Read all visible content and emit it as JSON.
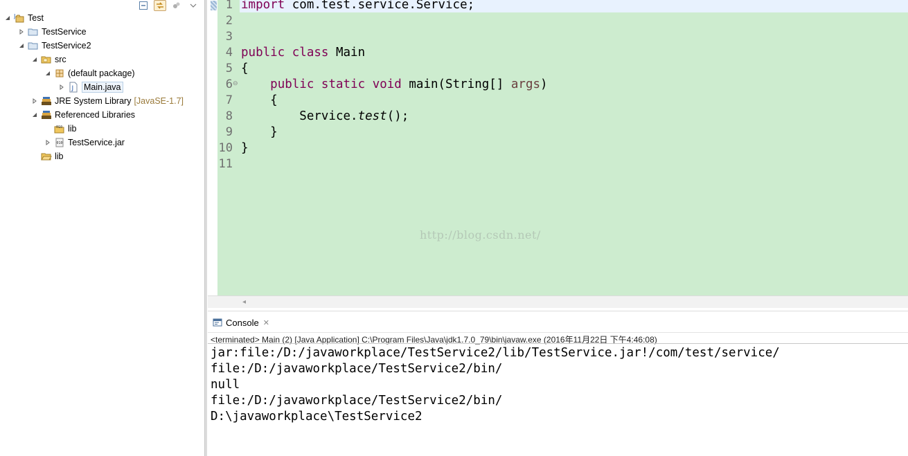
{
  "explorer": {
    "tree": [
      {
        "label": "Test",
        "decor": "",
        "icon": "project-icon",
        "twisty": "expanded"
      },
      {
        "label": "TestService",
        "decor": "",
        "icon": "project-folder-icon",
        "twisty": "collapsed"
      },
      {
        "label": "TestService2",
        "decor": "",
        "icon": "project-folder-icon",
        "twisty": "expanded"
      },
      {
        "label": "src",
        "decor": "",
        "icon": "source-folder-icon",
        "twisty": "expanded"
      },
      {
        "label": "(default package)",
        "decor": "",
        "icon": "package-icon",
        "twisty": "expanded"
      },
      {
        "label": "Main.java",
        "decor": "",
        "icon": "java-file-icon",
        "twisty": "collapsed"
      },
      {
        "label": "JRE System Library",
        "decor": "[JavaSE-1.7]",
        "icon": "library-icon",
        "twisty": "collapsed"
      },
      {
        "label": "Referenced Libraries",
        "decor": "",
        "icon": "library-icon",
        "twisty": "expanded"
      },
      {
        "label": "lib",
        "decor": "",
        "icon": "jar-folder-icon",
        "twisty": "none"
      },
      {
        "label": "TestService.jar",
        "decor": "",
        "icon": "jar-icon",
        "twisty": "collapsed"
      },
      {
        "label": "lib",
        "decor": "",
        "icon": "folder-icon",
        "twisty": "none"
      }
    ]
  },
  "editor": {
    "line_numbers": [
      "1",
      "2",
      "3",
      "4",
      "5",
      "6",
      "7",
      "8",
      "9",
      "10",
      "11"
    ],
    "lines": {
      "l1_kw": "import",
      "l1_rest": " com.test.service.Service;",
      "l4_kw1": "public",
      "l4_kw2": "class",
      "l4_rest": " Main",
      "l5": "{",
      "l6_kw1": "public",
      "l6_kw2": "static",
      "l6_kw3": "void",
      "l6_mid": " main(String[] ",
      "l6_param": "args",
      "l6_end": ")",
      "l7": "    {",
      "l8_pre": "        Service.",
      "l8_call": "test",
      "l8_end": "();",
      "l9": "    }",
      "l10": "}"
    },
    "watermark": "http://blog.csdn.net/"
  },
  "console": {
    "tab_label": "Console",
    "status": "<terminated> Main (2) [Java Application] C:\\Program Files\\Java\\jdk1.7.0_79\\bin\\javaw.exe (2016年11月22日 下午4:46:08)",
    "output": [
      "jar:file:/D:/javaworkplace/TestService2/lib/TestService.jar!/com/test/service/",
      "file:/D:/javaworkplace/TestService2/bin/",
      "null",
      "file:/D:/javaworkplace/TestService2/bin/",
      "D:\\javaworkplace\\TestService2"
    ]
  },
  "colors": {
    "editor_bg": "#cdeccf",
    "keyword": "#7f0055",
    "parameter": "#6a3e3e",
    "current_line": "#e8f2fe"
  }
}
